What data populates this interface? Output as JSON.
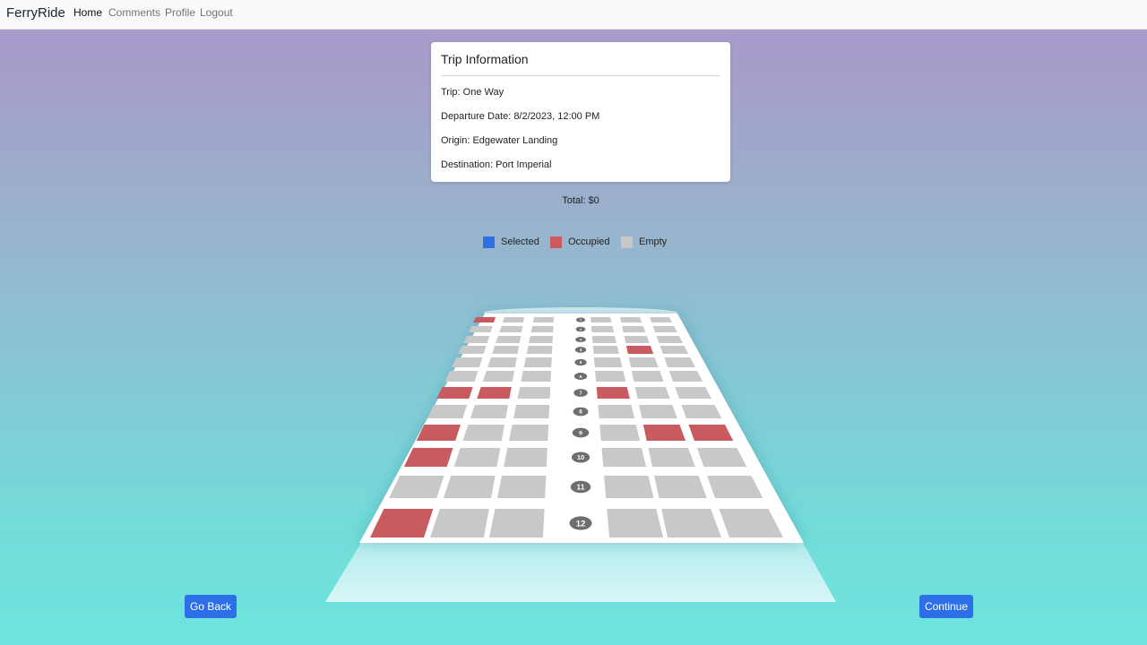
{
  "nav": {
    "brand": "FerryRide",
    "links": [
      "Home",
      "Comments",
      "Profile",
      "Logout"
    ]
  },
  "trip": {
    "title": "Trip Information",
    "trip_line": "Trip: One Way",
    "departure_line": "Departure Date: 8/2/2023, 12:00 PM",
    "origin_line": "Origin: Edgewater Landing",
    "destination_line": "Destination: Port Imperial"
  },
  "total": "Total: $0",
  "legend": [
    {
      "label": "Selected",
      "color": "#2f6fe0"
    },
    {
      "label": "Occupied",
      "color": "#cc5a61"
    },
    {
      "label": "Empty",
      "color": "#c8c8c8"
    }
  ],
  "colors": {
    "empty": "#c8c8c8",
    "occupied": "#c95a60",
    "selected": "#2f6fe0",
    "row_badge": "#6e6e6e"
  },
  "seat_map": {
    "row_labels": [
      "1",
      "2",
      "3",
      "4",
      "5",
      "6",
      "7",
      "8",
      "9",
      "10",
      "11",
      "12"
    ],
    "seats": [
      [
        "occupied",
        "empty",
        "empty",
        "empty",
        "empty",
        "empty"
      ],
      [
        "empty",
        "empty",
        "empty",
        "empty",
        "empty",
        "empty"
      ],
      [
        "empty",
        "empty",
        "empty",
        "empty",
        "empty",
        "empty"
      ],
      [
        "empty",
        "empty",
        "empty",
        "empty",
        "occupied",
        "empty"
      ],
      [
        "empty",
        "empty",
        "empty",
        "empty",
        "empty",
        "empty"
      ],
      [
        "empty",
        "empty",
        "empty",
        "empty",
        "empty",
        "empty"
      ],
      [
        "occupied",
        "occupied",
        "empty",
        "occupied",
        "empty",
        "empty"
      ],
      [
        "empty",
        "empty",
        "empty",
        "empty",
        "empty",
        "empty"
      ],
      [
        "occupied",
        "empty",
        "empty",
        "empty",
        "occupied",
        "occupied"
      ],
      [
        "occupied",
        "empty",
        "empty",
        "empty",
        "empty",
        "empty"
      ],
      [
        "empty",
        "empty",
        "empty",
        "empty",
        "empty",
        "empty"
      ],
      [
        "occupied",
        "empty",
        "empty",
        "empty",
        "empty",
        "empty"
      ]
    ]
  },
  "buttons": {
    "back": "Go Back",
    "continue": "Continue"
  }
}
